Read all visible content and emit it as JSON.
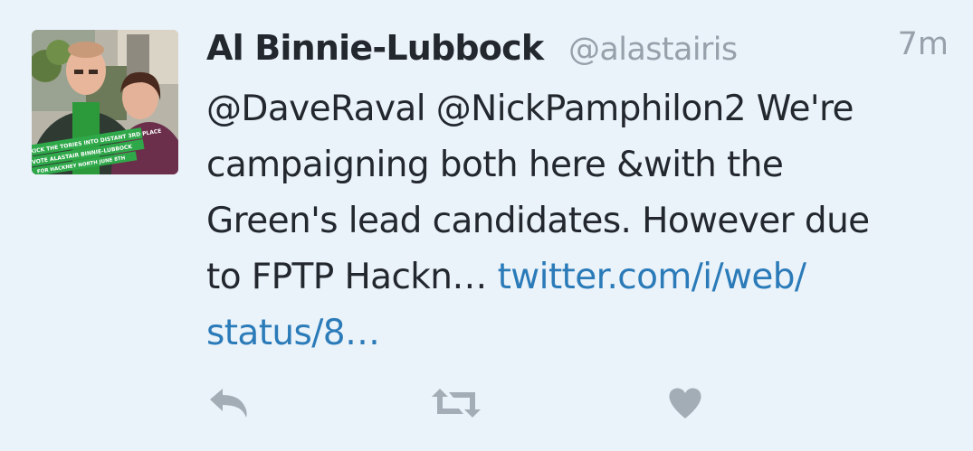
{
  "tweet": {
    "author": {
      "name": "Al Binnie-Lubbock",
      "handle": "@alastairis",
      "avatar_banner": [
        "KICK THE TORIES INTO DISTANT 3RD PLACE",
        "VOTE ALASTAIR BINNIE-LUBBOCK",
        "FOR HACKNEY NORTH JUNE 8TH"
      ]
    },
    "timestamp": "7m",
    "text": {
      "line1": "@DaveRaval @NickPamphilon2 We're",
      "line2": "campaigning both here &with the",
      "line3": "Green's lead candidates. However due",
      "line4_text": "to FPTP Hackn… ",
      "line4_link": "twitter.com/i/web/",
      "line5_link": "status/8…"
    },
    "actions": [
      {
        "name": "reply-icon"
      },
      {
        "name": "retweet-icon"
      },
      {
        "name": "like-icon"
      }
    ],
    "colors": {
      "background": "#ebf3fa",
      "text": "#22282d",
      "muted": "#96a1ab",
      "link": "#2b7bb9",
      "action": "#a3adb6"
    }
  }
}
